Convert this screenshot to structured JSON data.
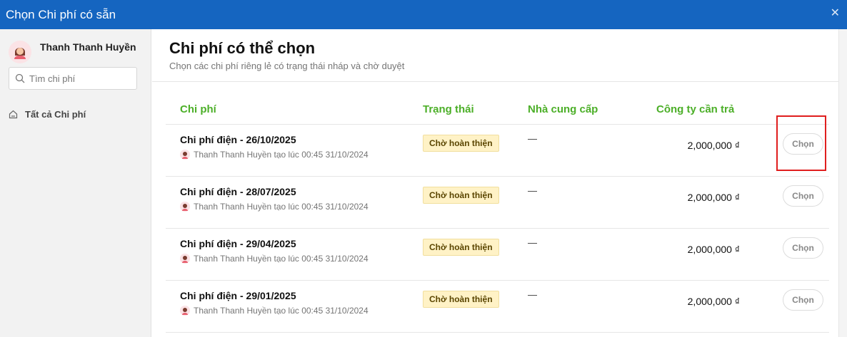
{
  "window": {
    "title": "Chọn Chi phí có sẵn"
  },
  "sidebar": {
    "user_name": "Thanh Thanh Huyền",
    "search_placeholder": "Tìm chi phí",
    "nav_items": [
      {
        "label": "Tất cả Chi phí",
        "icon": "home-icon"
      }
    ]
  },
  "main": {
    "title": "Chi phí có thể chọn",
    "subtitle": "Chọn các chi phí riêng lẻ có trạng thái nháp và chờ duyệt",
    "columns": {
      "expense": "Chi phí",
      "status": "Trạng thái",
      "supplier": "Nhà cung cấp",
      "company_pays": "Công ty cần trả"
    },
    "rows": [
      {
        "name": "Chi phí điện - 26/10/2025",
        "meta": "Thanh Thanh Huyền tạo lúc 00:45 31/10/2024",
        "status": "Chờ hoàn thiện",
        "supplier": "—",
        "amount": "2,000,000 ₫",
        "action": "Chọn"
      },
      {
        "name": "Chi phí điện - 28/07/2025",
        "meta": "Thanh Thanh Huyền tạo lúc 00:45 31/10/2024",
        "status": "Chờ hoàn thiện",
        "supplier": "—",
        "amount": "2,000,000 ₫",
        "action": "Chọn"
      },
      {
        "name": "Chi phí điện - 29/04/2025",
        "meta": "Thanh Thanh Huyền tạo lúc 00:45 31/10/2024",
        "status": "Chờ hoàn thiện",
        "supplier": "—",
        "amount": "2,000,000 ₫",
        "action": "Chọn"
      },
      {
        "name": "Chi phí điện - 29/01/2025",
        "meta": "Thanh Thanh Huyền tạo lúc 00:45 31/10/2024",
        "status": "Chờ hoàn thiện",
        "supplier": "—",
        "amount": "2,000,000 ₫",
        "action": "Chọn"
      }
    ]
  },
  "colors": {
    "titlebar": "#1565c0",
    "column_header": "#4caf28",
    "status_badge_bg": "#fff2c6",
    "highlight": "#e01e1e"
  }
}
